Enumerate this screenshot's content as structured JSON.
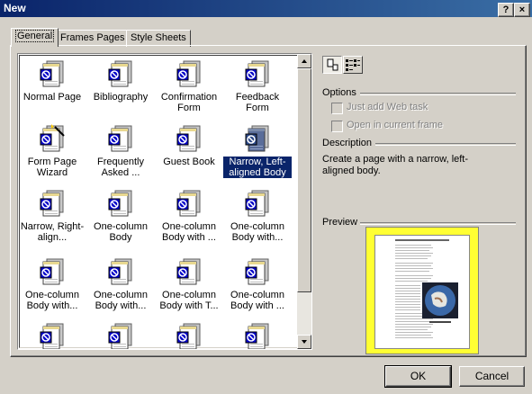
{
  "window": {
    "title": "New",
    "help_label": "?",
    "close_label": "×"
  },
  "tabs": [
    {
      "label": "General"
    },
    {
      "label": "Frames Pages"
    },
    {
      "label": "Style Sheets"
    }
  ],
  "templates": [
    {
      "label": "Normal Page"
    },
    {
      "label": "Bibliography"
    },
    {
      "label": "Confirmation Form"
    },
    {
      "label": "Feedback Form"
    },
    {
      "label": "Form Page Wizard"
    },
    {
      "label": "Frequently Asked ..."
    },
    {
      "label": "Guest Book"
    },
    {
      "label": "Narrow, Left-aligned Body"
    },
    {
      "label": "Narrow, Right-align..."
    },
    {
      "label": "One-column Body"
    },
    {
      "label": "One-column Body with ..."
    },
    {
      "label": "One-column Body with..."
    },
    {
      "label": "One-column Body with..."
    },
    {
      "label": "One-column Body with..."
    },
    {
      "label": "One-column Body with T..."
    },
    {
      "label": "One-column Body with ..."
    },
    {
      "label": ""
    },
    {
      "label": ""
    },
    {
      "label": ""
    },
    {
      "label": ""
    }
  ],
  "selected_index": 7,
  "options": {
    "heading": "Options",
    "add_web_task": "Just add Web task",
    "open_current_frame": "Open in current frame"
  },
  "description": {
    "heading": "Description",
    "text": "Create a page with a narrow, left-aligned body."
  },
  "preview": {
    "heading": "Preview"
  },
  "buttons": {
    "ok": "OK",
    "cancel": "Cancel"
  },
  "colors": {
    "titlebar": "#0a246a",
    "selection": "#0a246a",
    "preview_border": "#ffff33"
  },
  "icons": {
    "template": "page-template-icon",
    "wizard": "wizard-icon",
    "large_icons": "large-icons-view-icon",
    "list": "list-view-icon"
  }
}
